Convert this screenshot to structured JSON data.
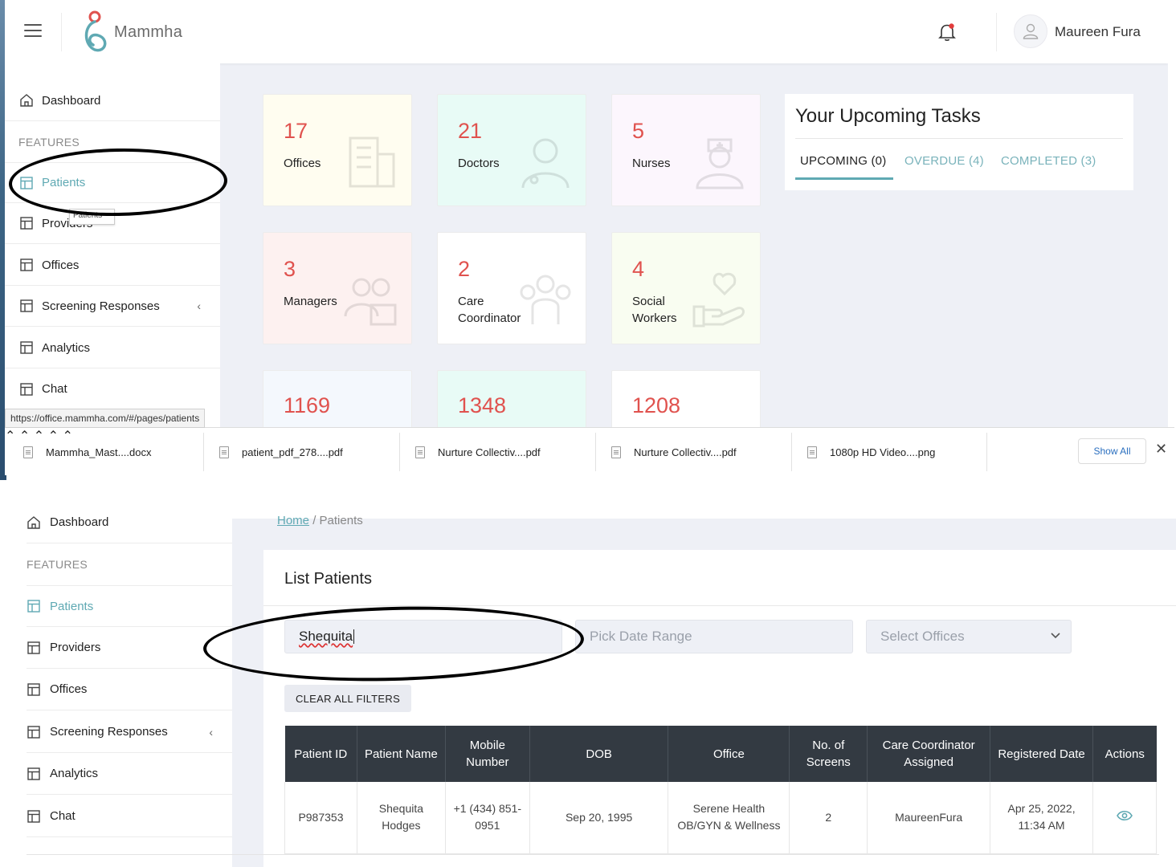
{
  "app": {
    "brand": "Mammha",
    "user": "Maureen Fura"
  },
  "sidebar": {
    "dashboard": "Dashboard",
    "section": "FEATURES",
    "items": [
      "Patients",
      "Providers",
      "Offices",
      "Screening Responses",
      "Analytics",
      "Chat"
    ],
    "tooltip": "Patients",
    "chevron": "‹"
  },
  "cards": [
    {
      "number": "17",
      "label": "Offices",
      "bg": "#fffdf0",
      "icon": "building-icon"
    },
    {
      "number": "21",
      "label": "Doctors",
      "bg": "#e8fbf6",
      "icon": "doctor-icon"
    },
    {
      "number": "5",
      "label": "Nurses",
      "bg": "#fcf6fd",
      "icon": "nurse-icon"
    },
    {
      "number": "3",
      "label": "Managers",
      "bg": "#fdf1f0",
      "icon": "managers-icon"
    },
    {
      "number": "2",
      "label": "Care Coordinator",
      "bg": "#ffffff",
      "icon": "coordinator-icon"
    },
    {
      "number": "4",
      "label": "Social Workers",
      "bg": "#f9fdf1",
      "icon": "hand-heart-icon"
    },
    {
      "number": "1169",
      "label": "",
      "bg": "#f4f8fd"
    },
    {
      "number": "1348",
      "label": "",
      "bg": "#e8fbf6"
    },
    {
      "number": "1208",
      "label": "",
      "bg": "#ffffff"
    }
  ],
  "tasks": {
    "title": "Your Upcoming Tasks",
    "tabs": [
      "UPCOMING (0)",
      "OVERDUE (4)",
      "COMPLETED (3)"
    ]
  },
  "status_url": "https://office.mammha.com/#/pages/patients",
  "downloads": {
    "files": [
      "Mammha_Mast....docx",
      "patient_pdf_278....pdf",
      "Nurture Collectiv....pdf",
      "Nurture Collectiv....pdf",
      "1080p HD Video....png"
    ],
    "show_all": "Show All",
    "close": "✕"
  },
  "breadcrumb": {
    "home": "Home",
    "sep": "/",
    "current": "Patients"
  },
  "list": {
    "title": "List Patients",
    "search_value": "Shequita",
    "date_placeholder": "Pick Date Range",
    "offices_placeholder": "Select Offices",
    "clear_filters": "CLEAR ALL FILTERS",
    "columns": [
      "Patient ID",
      "Patient Name",
      "Mobile Number",
      "DOB",
      "Office",
      "No. of Screens",
      "Care Coordinator Assigned",
      "Registered Date",
      "Actions"
    ],
    "rows": [
      {
        "id": "P987353",
        "name": "Shequita Hodges",
        "mobile": "+1 (434) 851-0951",
        "dob": "Sep 20, 1995",
        "office": "Serene Health OB/GYN & Wellness",
        "screens": "2",
        "coordinator": "MaureenFura",
        "registered": "Apr 25, 2022, 11:34 AM",
        "action_icon": "eye-icon"
      }
    ]
  },
  "colors": {
    "accent": "#5fa9b3",
    "number": "#e0524e",
    "table_header": "#333a42"
  }
}
